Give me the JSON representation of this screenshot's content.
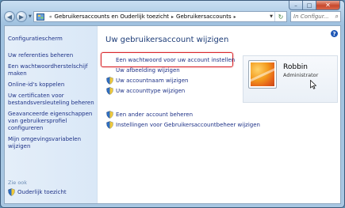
{
  "window": {
    "caption": {
      "minimize": "–",
      "maximize": "□",
      "close": "✕"
    }
  },
  "addressbar": {
    "breadcrumb": [
      "Gebruikersaccounts en Ouderlijk toezicht",
      "Gebruikersaccounts"
    ],
    "sep": "▸",
    "prefix": "«",
    "search_placeholder": "In Configur..."
  },
  "sidebar": {
    "home": "Configuratiescherm",
    "links": [
      "Uw referenties beheren",
      "Een wachtwoordherstelschijf maken",
      "Online-id's koppelen",
      "Uw certificaten voor bestandsversleuteling beheren",
      "Geavanceerde eigenschappen van gebruikersprofiel configureren",
      "Mijn omgevingsvariabelen wijzigen"
    ],
    "see_also": "Zie ook",
    "parental_control": "Ouderlijk toezicht"
  },
  "main": {
    "help": "?",
    "heading": "Uw gebruikersaccount wijzigen",
    "actions": [
      {
        "label": "Een wachtwoord voor uw account instellen",
        "shield": false
      },
      {
        "label": "Uw afbeelding wijzigen",
        "shield": false
      },
      {
        "label": "Uw accountnaam wijzigen",
        "shield": true
      },
      {
        "label": "Uw accounttype wijzigen",
        "shield": true
      }
    ],
    "actions2": [
      {
        "label": "Een ander account beheren",
        "shield": true
      },
      {
        "label": "Instellingen voor Gebruikersaccountbeheer wijzigen",
        "shield": true
      }
    ]
  },
  "user": {
    "name": "Robbin",
    "role": "Administrator"
  },
  "colors": {
    "link": "#1e3287",
    "highlight": "#d9252a",
    "heading": "#1e3d78"
  }
}
